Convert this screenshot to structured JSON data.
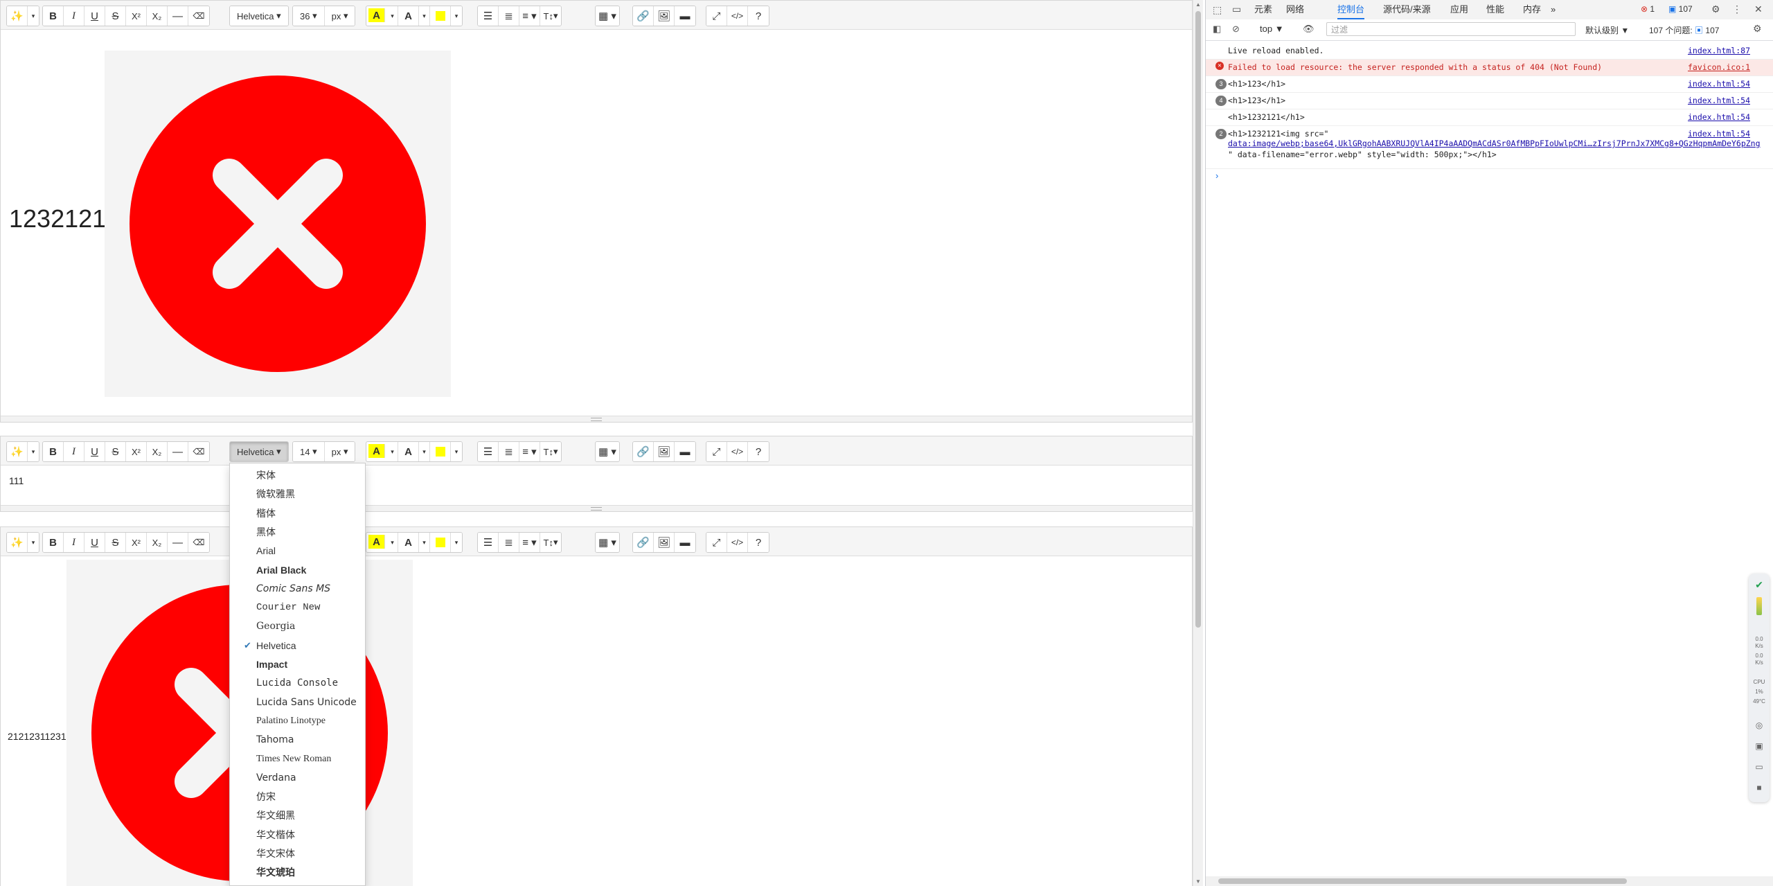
{
  "toolbar": {
    "magic_icon": "magic-wand-icon",
    "bold": "B",
    "italic": "I",
    "underline": "U",
    "strike": "S",
    "superscript": "X²",
    "subscript": "X₂",
    "hr": "—",
    "eraser": "eraser-icon",
    "font_family": "Helvetica",
    "unit": "px",
    "color_a": "A",
    "caret": "▾",
    "list_ul": "ul-icon",
    "list_ol": "ol-icon",
    "align": "align-icon",
    "line_height": "T↕",
    "table": "table-icon",
    "link": "link-icon",
    "picture": "image-icon",
    "video": "video-icon",
    "fullscreen": "⤢",
    "code": "</>",
    "help": "?",
    "highlight_color": "#ffff00"
  },
  "editors": [
    {
      "font_size": "36",
      "text": "1232121",
      "image": "error-icon"
    },
    {
      "font_size": "14",
      "text": "111"
    },
    {
      "font_size": "",
      "text": "21212311231",
      "image": "error-icon"
    }
  ],
  "font_menu": {
    "selected": "Helvetica",
    "items": [
      "宋体",
      "微软雅黑",
      "楷体",
      "黑体",
      "Arial",
      "Arial Black",
      "Comic Sans MS",
      "Courier New",
      "Georgia",
      "Helvetica",
      "Impact",
      "Lucida Console",
      "Lucida Sans Unicode",
      "Palatino Linotype",
      "Tahoma",
      "Times New Roman",
      "Verdana",
      "仿宋",
      "华文细黑",
      "华文楷体",
      "华文宋体",
      "华文琥珀"
    ]
  },
  "devtools": {
    "tabs": [
      "元素",
      "网络",
      "控制台",
      "源代码/来源",
      "应用",
      "性能",
      "内存"
    ],
    "active_tab": "控制台",
    "error_count": "1",
    "message_count": "107",
    "context": "top",
    "filter_placeholder": "过滤",
    "level": "默认级别",
    "issues": "107 个问题:",
    "issues_count": "107",
    "logs": [
      {
        "count": "",
        "text": "Live reload enabled.",
        "src": "index.html:87"
      },
      {
        "count": "",
        "text": "Failed to load resource: the server responded with a status of 404 (Not Found)",
        "src": "favicon.ico:1"
      },
      {
        "count": "3",
        "text": "<h1>123</h1>",
        "src": "index.html:54"
      },
      {
        "count": "4",
        "text": "<h1>123</h1>",
        "src": "index.html:54"
      },
      {
        "count": "",
        "text": "<h1>1232121</h1>",
        "src": "index.html:54"
      },
      {
        "count": "2",
        "text": "<h1>1232121<img src=\"",
        "text2": "data:image/webp;base64,UklGRgohAABXRUJQVlA4IP4aAADQmACdASr0AfMBPpFIoUwlpCMi…zIrsj7PrnJx7XMCg8+QGzHqpmAmDeY6pZng",
        "text3": "\" data-filename=\"error.webp\" style=\"width: 500px;\"></h1>",
        "src": "index.html:54"
      }
    ],
    "side_widget": [
      "0.0",
      "K/s",
      "0.0",
      "K/s",
      "CPU",
      "1%",
      "49°C"
    ]
  }
}
